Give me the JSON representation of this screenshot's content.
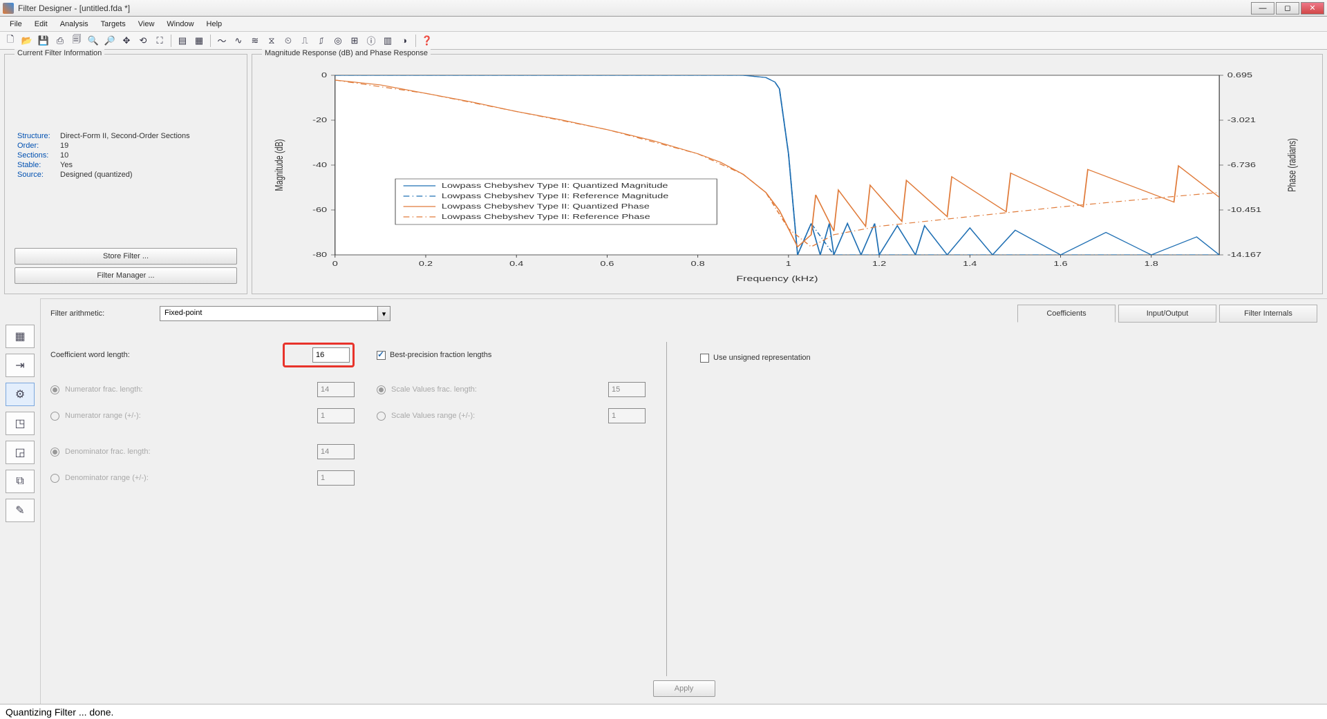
{
  "title": "Filter Designer -   [untitled.fda *]",
  "menu": [
    "File",
    "Edit",
    "Analysis",
    "Targets",
    "View",
    "Window",
    "Help"
  ],
  "toolbar_icons": [
    "new-icon",
    "open-icon",
    "save-icon",
    "print-icon",
    "print-preview-icon",
    "zoom-in-icon",
    "zoom-out-icon",
    "pan-icon",
    "reset-zoom-icon",
    "fullview-icon",
    "sep",
    "tile-icon",
    "cascade-icon",
    "sep",
    "magnitude-icon",
    "phase-icon",
    "magphase-icon",
    "groupdelay-icon",
    "phase-delay-icon",
    "impulse-icon",
    "step-icon",
    "polezero-icon",
    "coeff-icon",
    "info-icon",
    "filter-icon",
    "round-icon",
    "sep",
    "help-icon"
  ],
  "filter_info": {
    "heading": "Current Filter Information",
    "rows": [
      {
        "label": "Structure:",
        "value": "Direct-Form II, Second-Order Sections"
      },
      {
        "label": "Order:",
        "value": "19"
      },
      {
        "label": "Sections:",
        "value": "10"
      },
      {
        "label": "Stable:",
        "value": "Yes"
      },
      {
        "label": "Source:",
        "value": "Designed (quantized)"
      }
    ],
    "store_btn": "Store Filter ...",
    "manager_btn": "Filter Manager ..."
  },
  "plot": {
    "heading": "Magnitude Response (dB) and Phase Response",
    "xlabel": "Frequency (kHz)",
    "ylabel_left": "Magnitude (dB)",
    "ylabel_right": "Phase (radians)",
    "xticks": [
      "0",
      "0.2",
      "0.4",
      "0.6",
      "0.8",
      "1",
      "1.2",
      "1.4",
      "1.6",
      "1.8"
    ],
    "yticks_left": [
      "0",
      "-20",
      "-40",
      "-60",
      "-80"
    ],
    "yticks_right": [
      "0.695",
      "-3.021",
      "-6.736",
      "-10.451",
      "-14.167"
    ],
    "legend": [
      "Lowpass Chebyshev Type II: Quantized Magnitude",
      "Lowpass Chebyshev Type II: Reference Magnitude",
      "Lowpass Chebyshev Type II: Quantized Phase",
      "Lowpass Chebyshev Type II: Reference Phase"
    ]
  },
  "chart_data": {
    "type": "line",
    "title": "Magnitude Response (dB) and Phase Response",
    "xlabel": "Frequency (kHz)",
    "ylabel_left": "Magnitude (dB)",
    "ylabel_right": "Phase (radians)",
    "xlim": [
      0,
      1.95
    ],
    "ylim_left": [
      -80,
      0
    ],
    "ylim_right": [
      -14.167,
      0.695
    ],
    "series": [
      {
        "name": "Lowpass Chebyshev Type II: Quantized Magnitude",
        "axis": "left",
        "color": "#1f6fb3",
        "style": "solid",
        "x": [
          0,
          0.2,
          0.4,
          0.6,
          0.8,
          0.9,
          0.95,
          0.97,
          0.98,
          1.0,
          1.02,
          1.05,
          1.07,
          1.09,
          1.1,
          1.13,
          1.16,
          1.19,
          1.2,
          1.24,
          1.28,
          1.3,
          1.35,
          1.4,
          1.45,
          1.5,
          1.6,
          1.7,
          1.8,
          1.9,
          1.95
        ],
        "y": [
          0,
          0,
          0,
          0,
          0,
          0,
          -1,
          -3,
          -6,
          -35,
          -80,
          -66,
          -80,
          -66,
          -80,
          -66,
          -80,
          -66,
          -80,
          -67,
          -80,
          -67,
          -80,
          -68,
          -80,
          -69,
          -80,
          -70,
          -80,
          -72,
          -80
        ]
      },
      {
        "name": "Lowpass Chebyshev Type II: Reference Magnitude",
        "axis": "left",
        "color": "#1f6fb3",
        "style": "dashdot",
        "x": [
          0,
          0.2,
          0.4,
          0.6,
          0.8,
          0.9,
          0.95,
          0.97,
          0.98,
          1.0,
          1.02,
          1.05,
          1.1,
          1.2,
          1.3,
          1.5,
          1.7,
          1.9,
          1.95
        ],
        "y": [
          0,
          0,
          0,
          0,
          0,
          0,
          -1,
          -3,
          -6,
          -35,
          -80,
          -66,
          -80,
          -80,
          -80,
          -80,
          -80,
          -80,
          -80
        ]
      },
      {
        "name": "Lowpass Chebyshev Type II: Quantized Phase",
        "axis": "right",
        "color": "#e07b3a",
        "style": "solid",
        "x": [
          0,
          0.1,
          0.2,
          0.3,
          0.4,
          0.5,
          0.6,
          0.7,
          0.8,
          0.85,
          0.9,
          0.95,
          0.98,
          1.0,
          1.02,
          1.05,
          1.06,
          1.1,
          1.11,
          1.17,
          1.18,
          1.25,
          1.26,
          1.35,
          1.36,
          1.48,
          1.49,
          1.65,
          1.66,
          1.85,
          1.86,
          1.95
        ],
        "y": [
          0.3,
          -0.1,
          -0.8,
          -1.5,
          -2.3,
          -3.0,
          -3.8,
          -4.7,
          -5.8,
          -6.5,
          -7.5,
          -9.0,
          -10.5,
          -12.0,
          -13.5,
          -12.5,
          -9.2,
          -12.2,
          -8.8,
          -11.8,
          -8.4,
          -11.4,
          -8.0,
          -11.0,
          -7.7,
          -10.6,
          -7.4,
          -10.2,
          -7.1,
          -9.8,
          -6.8,
          -9.4
        ]
      },
      {
        "name": "Lowpass Chebyshev Type II: Reference Phase",
        "axis": "right",
        "color": "#e07b3a",
        "style": "dashdot",
        "x": [
          0,
          0.2,
          0.4,
          0.6,
          0.8,
          0.9,
          0.95,
          1.0,
          1.05,
          1.1,
          1.2,
          1.4,
          1.6,
          1.8,
          1.95
        ],
        "y": [
          0.3,
          -0.8,
          -2.3,
          -3.8,
          -5.8,
          -7.5,
          -9.0,
          -12.0,
          -13.5,
          -12.5,
          -11.8,
          -11.0,
          -10.2,
          -9.5,
          -9.0
        ]
      }
    ]
  },
  "settings": {
    "arith_label": "Filter arithmetic:",
    "arith_value": "Fixed-point",
    "tabs": [
      "Coefficients",
      "Input/Output",
      "Filter Internals"
    ],
    "coeff_word_len_label": "Coefficient word length:",
    "coeff_word_len_value": "16",
    "best_prec_label": "Best-precision fraction lengths",
    "best_prec_checked": true,
    "unsigned_label": "Use unsigned representation",
    "unsigned_checked": false,
    "rows_left": [
      {
        "type": "radio",
        "checked": true,
        "label": "Numerator frac. length:",
        "value": "14",
        "disabled": true
      },
      {
        "type": "radio",
        "checked": false,
        "label": "Numerator range (+/-):",
        "value": "1",
        "disabled": true
      },
      {
        "type": "spacer"
      },
      {
        "type": "radio",
        "checked": true,
        "label": "Denominator frac. length:",
        "value": "14",
        "disabled": true
      },
      {
        "type": "radio",
        "checked": false,
        "label": "Denominator range (+/-):",
        "value": "1",
        "disabled": true
      }
    ],
    "rows_mid": [
      {
        "type": "radio",
        "checked": true,
        "label": "Scale Values frac. length:",
        "value": "15",
        "disabled": true
      },
      {
        "type": "radio",
        "checked": false,
        "label": "Scale Values range (+/-):",
        "value": "1",
        "disabled": true
      }
    ],
    "apply_label": "Apply"
  },
  "status": "Quantizing Filter ... done."
}
